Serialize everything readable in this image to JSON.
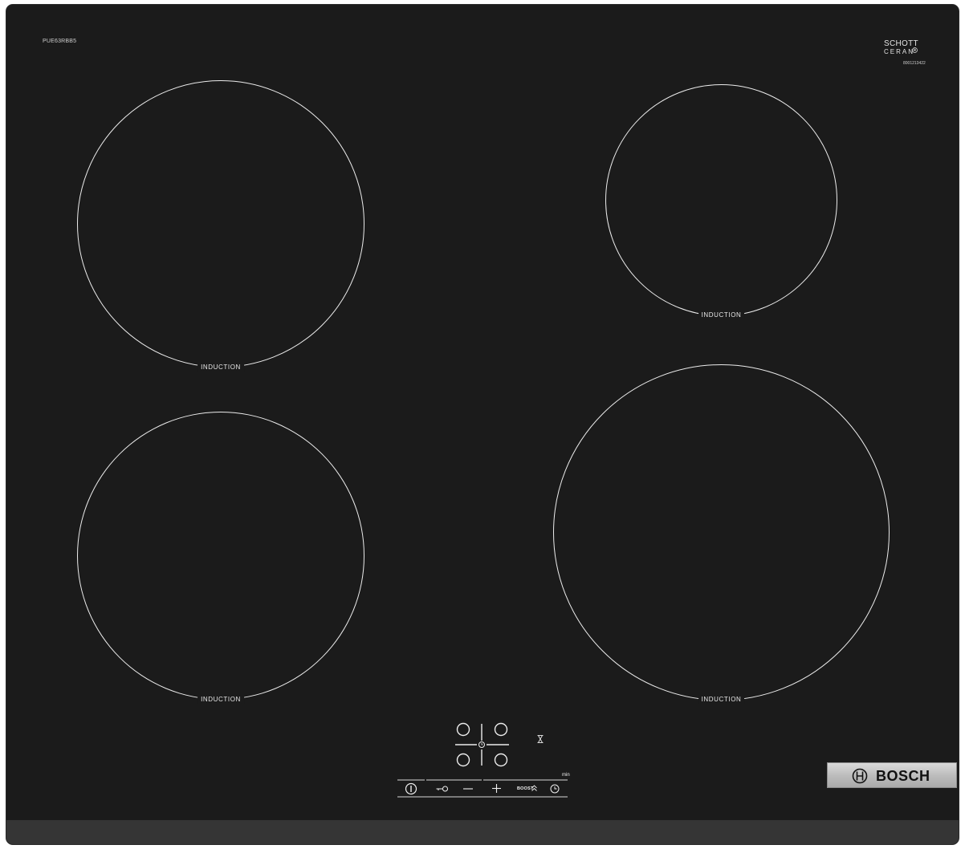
{
  "product": {
    "model_code": "PUE63RBB5",
    "serial_code": "8001213422",
    "glass_brand_line1": "SCHOTT",
    "glass_brand_line2": "CERAN"
  },
  "zones": [
    {
      "position": "back-left",
      "label": "INDUCTION"
    },
    {
      "position": "front-left",
      "label": "INDUCTION"
    },
    {
      "position": "back-right",
      "label": "INDUCTION"
    },
    {
      "position": "front-right",
      "label": "INDUCTION"
    }
  ],
  "controls": {
    "boost_label": "BOOST",
    "timer_unit_label": "min",
    "buttons": [
      "power-icon",
      "childlock-key-icon",
      "minus-icon",
      "plus-icon",
      "boost-chevrons-icon",
      "timer-clock-icon"
    ],
    "zone_selector_icon": "zone-selector-grid-icon",
    "hourglass_icon": "hourglass-icon"
  },
  "brand": {
    "name": "BOSCH",
    "logo_icon": "bosch-armature-icon"
  },
  "colors": {
    "glass": "#1b1b1b",
    "frame": "#353535",
    "markings": "#ececec",
    "badge": "#c4c4c4"
  }
}
